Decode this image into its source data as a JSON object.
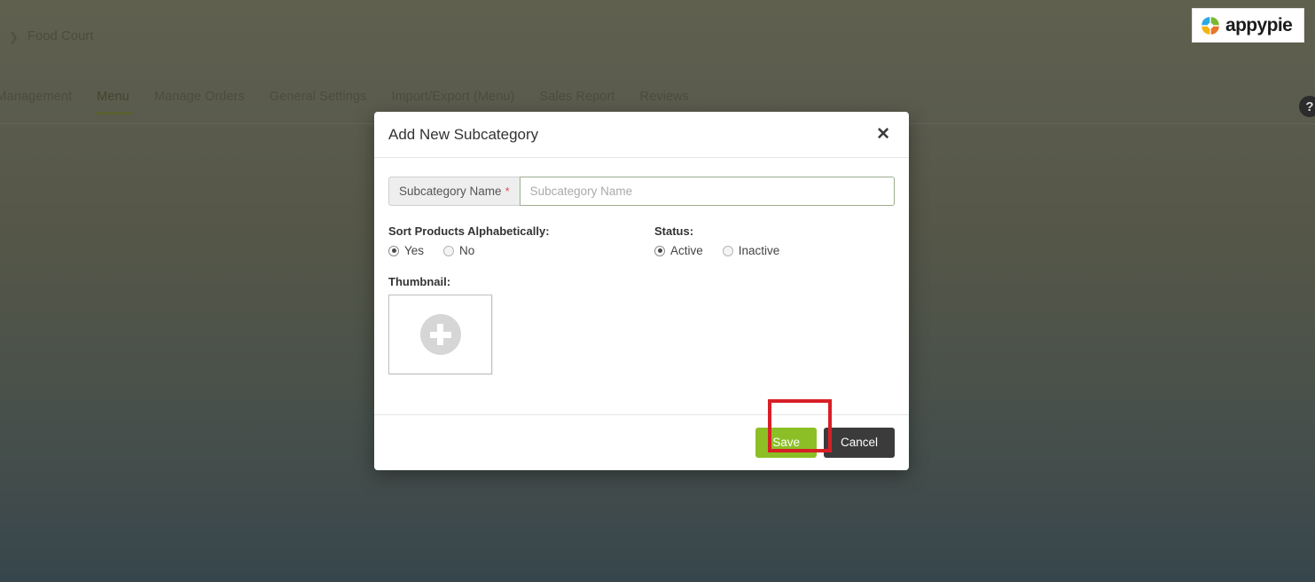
{
  "breadcrumb": {
    "chevron_icon": "chevron-right-icon",
    "label": "Food Court"
  },
  "brand": {
    "logo_icon": "appypie-pinwheel-icon",
    "name": "appypie",
    "colors": {
      "blue": "#2ba9e0",
      "green": "#7cb82f",
      "yellow": "#f6b312",
      "orange": "#e8752a"
    }
  },
  "tabs": [
    {
      "label": "rant Management",
      "active": false
    },
    {
      "label": "Menu",
      "active": true
    },
    {
      "label": "Manage Orders",
      "active": false
    },
    {
      "label": "General Settings",
      "active": false
    },
    {
      "label": "Import/Export (Menu)",
      "active": false
    },
    {
      "label": "Sales Report",
      "active": false
    },
    {
      "label": "Reviews",
      "active": false
    }
  ],
  "help": {
    "icon": "help-circle-icon",
    "label": "?"
  },
  "modal": {
    "title": "Add New Subcategory",
    "close_icon": "close-icon",
    "close_label": "✕",
    "name_field": {
      "addon_label": "Subcategory Name",
      "required_marker": "*",
      "placeholder": "Subcategory Name",
      "value": ""
    },
    "sort": {
      "label": "Sort Products Alphabetically:",
      "options": [
        {
          "label": "Yes",
          "selected": true
        },
        {
          "label": "No",
          "selected": false
        }
      ]
    },
    "status": {
      "label": "Status:",
      "options": [
        {
          "label": "Active",
          "selected": true
        },
        {
          "label": "Inactive",
          "selected": false
        }
      ]
    },
    "thumbnail": {
      "label": "Thumbnail:",
      "upload_icon": "plus-circle-icon"
    },
    "footer": {
      "save_label": "Save",
      "cancel_label": "Cancel",
      "save_color": "#8cbf26",
      "cancel_color": "#3b3b3b"
    }
  },
  "annotation": {
    "highlight_color": "#d81f26",
    "target": "save-button"
  }
}
